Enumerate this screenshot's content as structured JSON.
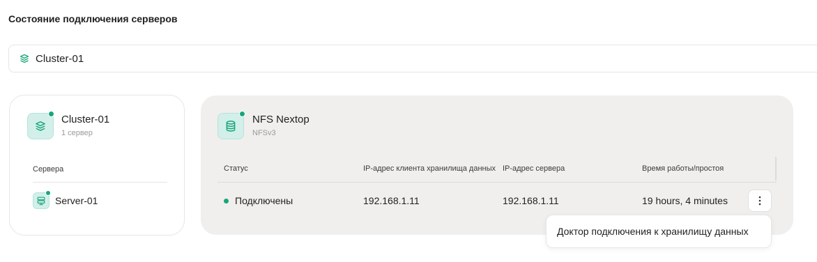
{
  "page": {
    "title": "Состояние подключения серверов"
  },
  "colors": {
    "accent": "#17a67a",
    "tile_bg": "#d3efea",
    "card_bg": "#f0efed"
  },
  "cluster_select": {
    "icon": "layers-icon",
    "value": "Cluster-01"
  },
  "cluster_card": {
    "icon": "layers-icon",
    "title": "Cluster-01",
    "subtitle": "1 сервер",
    "servers_label": "Сервера",
    "servers": [
      {
        "name": "Server-01",
        "icon": "server-icon",
        "online": true
      }
    ]
  },
  "storage_card": {
    "icon": "database-icon",
    "title": "NFS Nextop",
    "subtitle": "NFSv3",
    "columns": [
      "Статус",
      "IP-адрес клиента хранилища данных",
      "IP-адрес сервера",
      "Время работы/простоя"
    ],
    "rows": [
      {
        "status": "Подключены",
        "client_ip": "192.168.1.11",
        "server_ip": "192.168.1.11",
        "uptime": "19 hours, 4 minutes"
      }
    ],
    "actions_icon": "more-vertical-icon"
  },
  "dropdown": {
    "items": [
      "Доктор подключения к хранилищу данных"
    ]
  }
}
